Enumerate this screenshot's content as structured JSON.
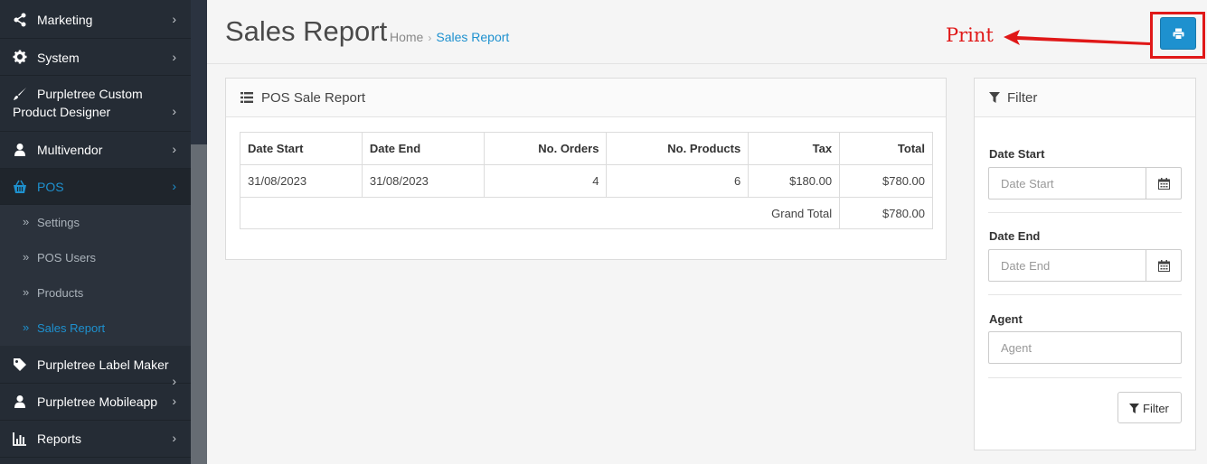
{
  "sidebar": {
    "items": [
      {
        "label": "Marketing",
        "icon": "share-icon"
      },
      {
        "label": "System",
        "icon": "gear-icon"
      },
      {
        "label": "Purpletree Custom Product Designer",
        "icon": "brush-icon"
      },
      {
        "label": "Multivendor",
        "icon": "user-icon"
      },
      {
        "label": "POS",
        "icon": "basket-icon"
      },
      {
        "label": "Purpletree Label Maker",
        "icon": "tag-icon"
      },
      {
        "label": "Purpletree Mobileapp",
        "icon": "user-icon"
      },
      {
        "label": "Reports",
        "icon": "bar-chart-icon"
      }
    ],
    "pos_subitems": [
      "Settings",
      "POS Users",
      "Products",
      "Sales Report"
    ],
    "designer_line1": "Purpletree Custom",
    "designer_line2": "Product Designer"
  },
  "header": {
    "title": "Sales Report",
    "breadcrumb": [
      "Home",
      "Sales Report"
    ],
    "annotation": "Print",
    "print_icon": "print-icon"
  },
  "report": {
    "title": "POS Sale Report",
    "columns": [
      "Date Start",
      "Date End",
      "No. Orders",
      "No. Products",
      "Tax",
      "Total"
    ],
    "rows": [
      [
        "31/08/2023",
        "31/08/2023",
        "4",
        "6",
        "$180.00",
        "$780.00"
      ]
    ],
    "grand_total_label": "Grand Total",
    "grand_total_value": "$780.00"
  },
  "filter": {
    "title": "Filter",
    "date_start_label": "Date Start",
    "date_start_placeholder": "Date Start",
    "date_end_label": "Date End",
    "date_end_placeholder": "Date End",
    "agent_label": "Agent",
    "agent_placeholder": "Agent",
    "button_label": "Filter"
  },
  "colors": {
    "accent": "#1e91cf",
    "sidebar_bg": "#252c35",
    "annotation": "#e01818"
  }
}
